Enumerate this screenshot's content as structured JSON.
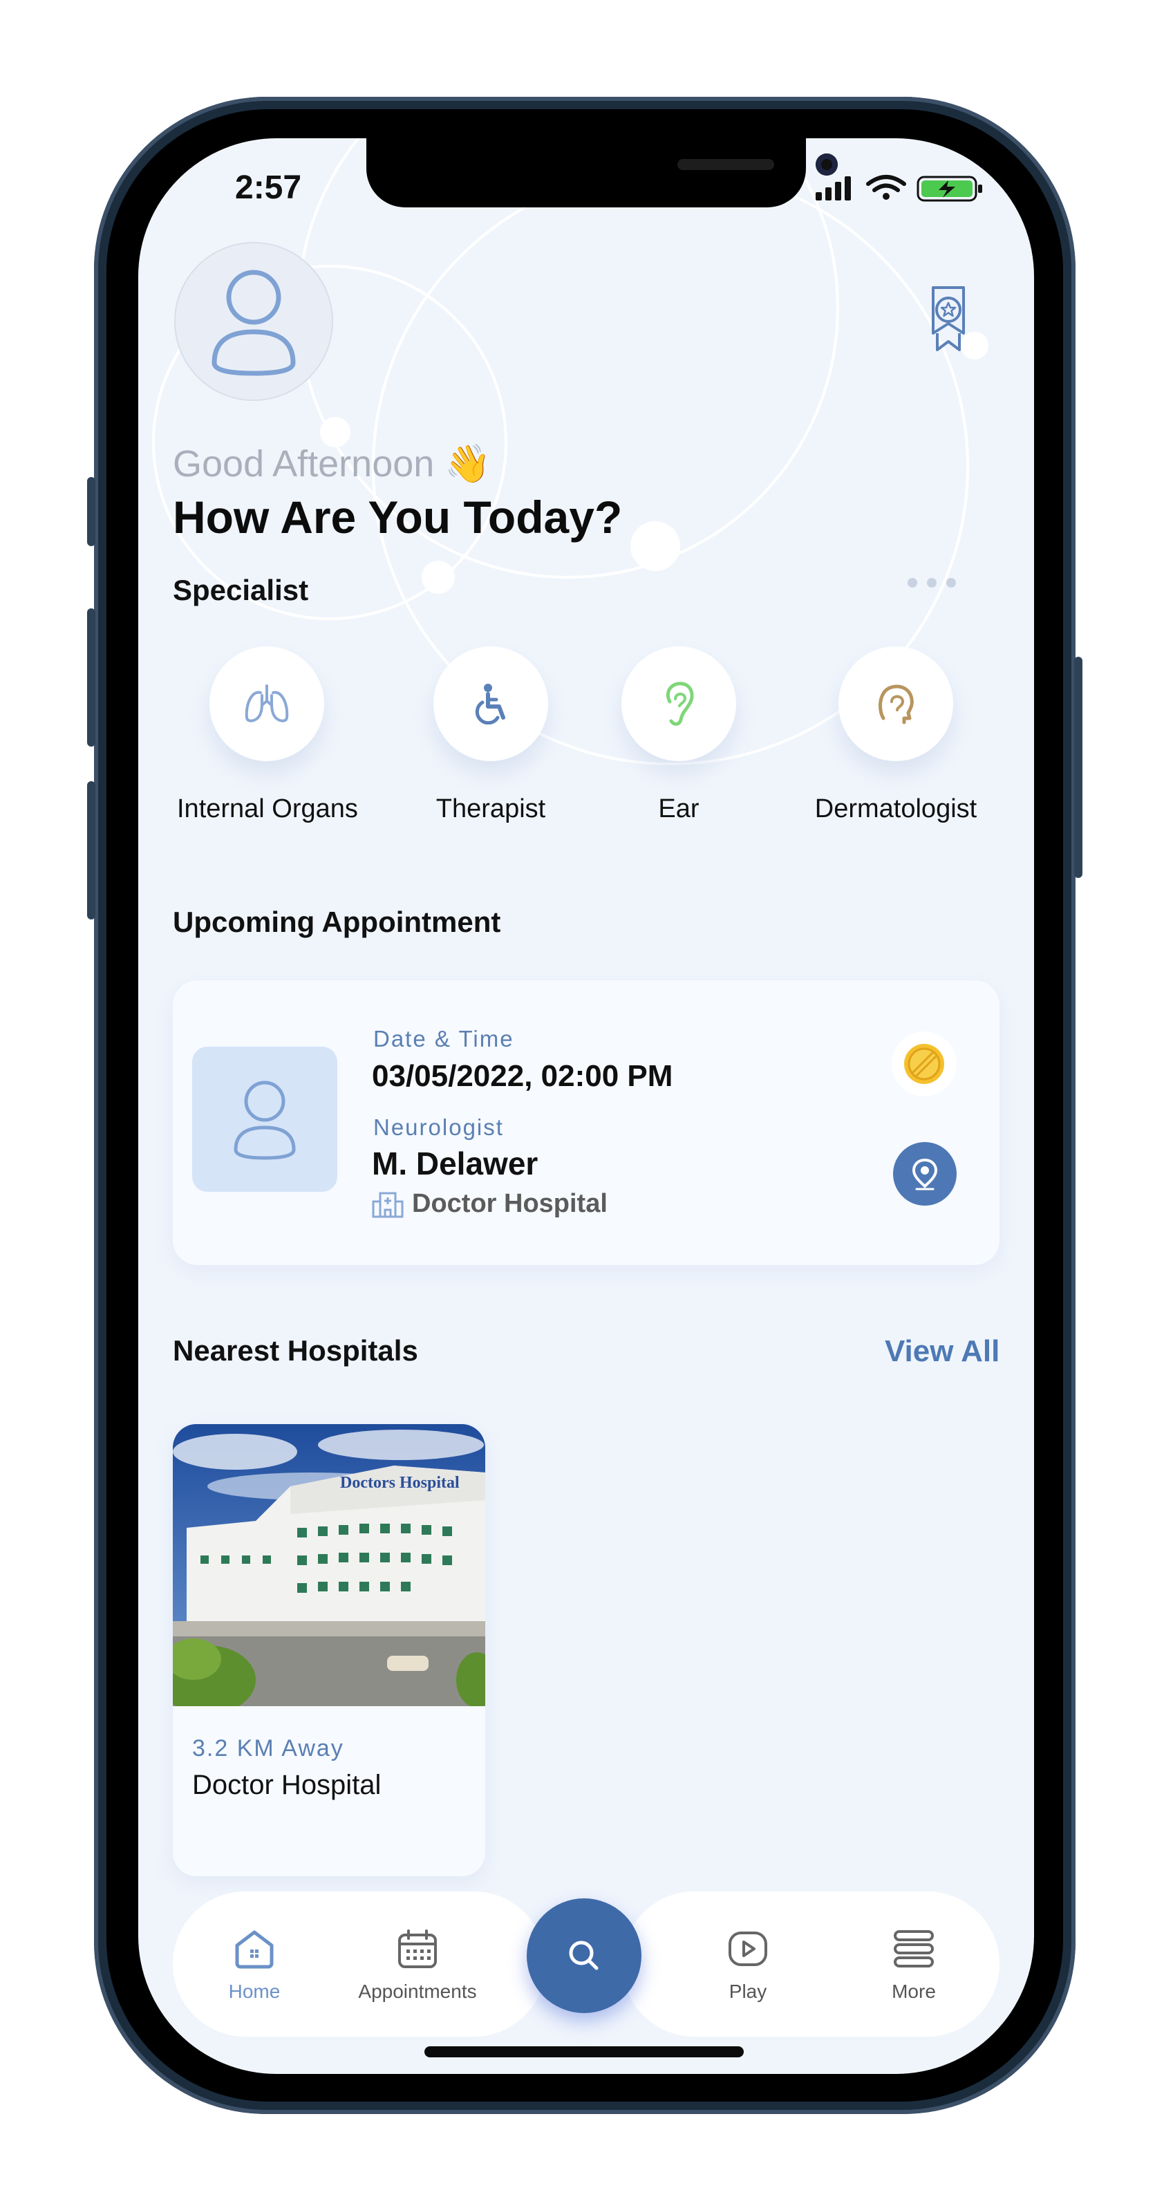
{
  "status_bar": {
    "time": "2:57"
  },
  "header": {
    "greeting": "Good Afternoon 👋",
    "headline": "How Are You Today?"
  },
  "specialist": {
    "title": "Specialist",
    "items": [
      {
        "label": "Internal Organs",
        "icon": "lungs-icon"
      },
      {
        "label": "Therapist",
        "icon": "wheelchair-icon"
      },
      {
        "label": "Ear",
        "icon": "ear-icon"
      },
      {
        "label": "Dermatologist",
        "icon": "head-icon"
      }
    ]
  },
  "appointment": {
    "title": "Upcoming Appointment",
    "datetime_label": "Date & Time",
    "datetime": "03/05/2022, 02:00 PM",
    "specialty": "Neurologist",
    "doctor": "M. Delawer",
    "hospital": "Doctor Hospital"
  },
  "hospitals": {
    "title": "Nearest Hospitals",
    "view_all": "View All",
    "items": [
      {
        "distance": "3.2 KM Away",
        "name": "Doctor Hospital",
        "sign": "Doctors Hospital"
      }
    ]
  },
  "nav": {
    "items": [
      {
        "label": "Home",
        "icon": "home-icon",
        "active": true
      },
      {
        "label": "Appointments",
        "icon": "calendar-icon"
      },
      {
        "label": "Play",
        "icon": "play-icon"
      },
      {
        "label": "More",
        "icon": "more-icon"
      }
    ]
  },
  "colors": {
    "accent": "#4d79b4",
    "background": "#f0f5fc",
    "card": "#f7faff"
  }
}
